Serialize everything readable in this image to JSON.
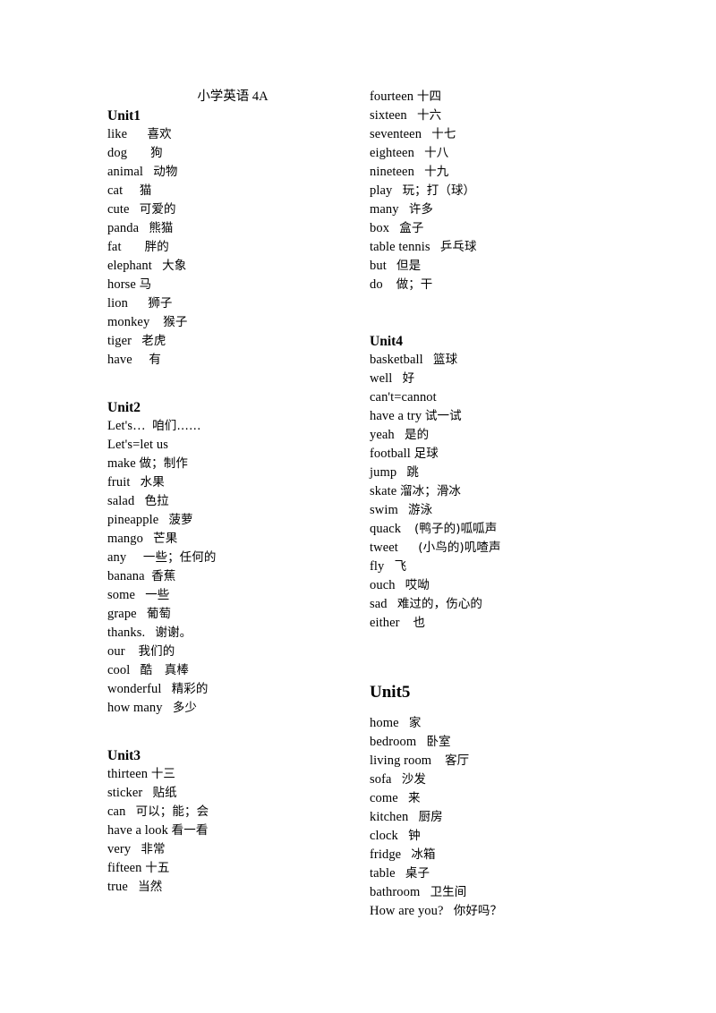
{
  "document": {
    "title": "小学英语 4A"
  },
  "columns": {
    "left": [
      {
        "kind": "heading",
        "label": "Unit1",
        "size": "normal"
      },
      {
        "kind": "entry",
        "term": "like",
        "sep": "      ",
        "gloss": "喜欢"
      },
      {
        "kind": "entry",
        "term": "dog",
        "sep": "       ",
        "gloss": "狗"
      },
      {
        "kind": "entry",
        "term": "animal",
        "sep": "   ",
        "gloss": "动物"
      },
      {
        "kind": "entry",
        "term": "cat",
        "sep": "     ",
        "gloss": "猫"
      },
      {
        "kind": "entry",
        "term": "cute",
        "sep": "   ",
        "gloss": "可爱的"
      },
      {
        "kind": "entry",
        "term": "panda",
        "sep": "   ",
        "gloss": "熊猫"
      },
      {
        "kind": "entry",
        "term": "fat",
        "sep": "       ",
        "gloss": "胖的"
      },
      {
        "kind": "entry",
        "term": "elephant",
        "sep": "   ",
        "gloss": "大象"
      },
      {
        "kind": "entry",
        "term": "horse",
        "sep": " ",
        "gloss": "马"
      },
      {
        "kind": "entry",
        "term": "lion",
        "sep": "      ",
        "gloss": "狮子"
      },
      {
        "kind": "entry",
        "term": "monkey",
        "sep": "    ",
        "gloss": "猴子"
      },
      {
        "kind": "entry",
        "term": "tiger",
        "sep": "   ",
        "gloss": "老虎"
      },
      {
        "kind": "entry",
        "term": "have",
        "sep": "     ",
        "gloss": "有"
      },
      {
        "kind": "spacer",
        "size": "normal"
      },
      {
        "kind": "spacer",
        "size": "half"
      },
      {
        "kind": "heading",
        "label": "Unit2",
        "size": "normal"
      },
      {
        "kind": "entry",
        "term": "Let's…",
        "sep": "  ",
        "gloss": "咱们……"
      },
      {
        "kind": "entry",
        "term": "Let's=let us",
        "sep": "",
        "gloss": ""
      },
      {
        "kind": "entry",
        "term": "make",
        "sep": " ",
        "gloss": "做；制作"
      },
      {
        "kind": "entry",
        "term": "fruit",
        "sep": "   ",
        "gloss": "水果"
      },
      {
        "kind": "entry",
        "term": "salad",
        "sep": "   ",
        "gloss": "色拉"
      },
      {
        "kind": "entry",
        "term": "pineapple",
        "sep": "   ",
        "gloss": "菠萝"
      },
      {
        "kind": "entry",
        "term": "mango",
        "sep": "   ",
        "gloss": "芒果"
      },
      {
        "kind": "entry",
        "term": "any",
        "sep": "     ",
        "gloss": "一些；任何的"
      },
      {
        "kind": "entry",
        "term": "banana",
        "sep": "  ",
        "gloss": "香蕉"
      },
      {
        "kind": "entry",
        "term": "some",
        "sep": "   ",
        "gloss": "一些"
      },
      {
        "kind": "entry",
        "term": "grape",
        "sep": "   ",
        "gloss": "葡萄"
      },
      {
        "kind": "entry",
        "term": "thanks.",
        "sep": "   ",
        "gloss": "谢谢。"
      },
      {
        "kind": "entry",
        "term": "our",
        "sep": "    ",
        "gloss": "我们的"
      },
      {
        "kind": "entry",
        "term": "cool",
        "sep": "   ",
        "gloss": "酷　真棒"
      },
      {
        "kind": "entry",
        "term": "wonderful",
        "sep": "   ",
        "gloss": "精彩的"
      },
      {
        "kind": "entry",
        "term": "how many",
        "sep": "   ",
        "gloss": "多少"
      },
      {
        "kind": "spacer",
        "size": "normal"
      },
      {
        "kind": "spacer",
        "size": "half"
      },
      {
        "kind": "heading",
        "label": "Unit3",
        "size": "normal"
      },
      {
        "kind": "entry",
        "term": "thirteen",
        "sep": " ",
        "gloss": "十三"
      },
      {
        "kind": "entry",
        "term": "sticker",
        "sep": "   ",
        "gloss": "贴纸"
      },
      {
        "kind": "entry",
        "term": "can",
        "sep": "   ",
        "gloss": "可以；能；会"
      },
      {
        "kind": "entry",
        "term": "have a look",
        "sep": " ",
        "gloss": "看一看"
      },
      {
        "kind": "entry",
        "term": "very",
        "sep": "   ",
        "gloss": "非常"
      },
      {
        "kind": "entry",
        "term": "fifteen",
        "sep": " ",
        "gloss": "十五"
      },
      {
        "kind": "entry",
        "term": "true",
        "sep": "   ",
        "gloss": "当然"
      }
    ],
    "right": [
      {
        "kind": "entry",
        "term": "fourteen",
        "sep": " ",
        "gloss": "十四"
      },
      {
        "kind": "entry",
        "term": "sixteen",
        "sep": "   ",
        "gloss": "十六"
      },
      {
        "kind": "entry",
        "term": "seventeen",
        "sep": "   ",
        "gloss": "十七"
      },
      {
        "kind": "entry",
        "term": "eighteen",
        "sep": "   ",
        "gloss": "十八"
      },
      {
        "kind": "entry",
        "term": "nineteen",
        "sep": "   ",
        "gloss": "十九"
      },
      {
        "kind": "entry",
        "term": "play",
        "sep": "   ",
        "gloss": "玩；打（球）"
      },
      {
        "kind": "entry",
        "term": "many",
        "sep": "   ",
        "gloss": "许多"
      },
      {
        "kind": "entry",
        "term": "box",
        "sep": "   ",
        "gloss": "盒子"
      },
      {
        "kind": "entry",
        "term": "table tennis",
        "sep": "   ",
        "gloss": "乒乓球"
      },
      {
        "kind": "entry",
        "term": "but",
        "sep": "   ",
        "gloss": "但是"
      },
      {
        "kind": "entry",
        "term": "do",
        "sep": "    ",
        "gloss": "做；干"
      },
      {
        "kind": "spacer",
        "size": "normal"
      },
      {
        "kind": "spacer",
        "size": "normal"
      },
      {
        "kind": "heading",
        "label": "Unit4",
        "size": "normal"
      },
      {
        "kind": "entry",
        "term": "basketball",
        "sep": "   ",
        "gloss": "篮球"
      },
      {
        "kind": "entry",
        "term": "well",
        "sep": "   ",
        "gloss": "好"
      },
      {
        "kind": "entry",
        "term": "can't=cannot",
        "sep": "",
        "gloss": ""
      },
      {
        "kind": "entry",
        "term": "have a try",
        "sep": " ",
        "gloss": "试一试"
      },
      {
        "kind": "entry",
        "term": "yeah",
        "sep": "   ",
        "gloss": "是的"
      },
      {
        "kind": "entry",
        "term": "football",
        "sep": " ",
        "gloss": "足球"
      },
      {
        "kind": "entry",
        "term": "jump",
        "sep": "   ",
        "gloss": "跳"
      },
      {
        "kind": "entry",
        "term": "skate",
        "sep": " ",
        "gloss": "溜冰；滑冰"
      },
      {
        "kind": "entry",
        "term": "swim",
        "sep": "   ",
        "gloss": "游泳"
      },
      {
        "kind": "entry",
        "term": "quack",
        "sep": "    ",
        "gloss": "(鸭子的)呱呱声"
      },
      {
        "kind": "entry",
        "term": "tweet",
        "sep": "      ",
        "gloss": "(小鸟的)叽喳声"
      },
      {
        "kind": "entry",
        "term": "fly",
        "sep": "   ",
        "gloss": "飞"
      },
      {
        "kind": "entry",
        "term": "ouch",
        "sep": "   ",
        "gloss": "哎呦"
      },
      {
        "kind": "entry",
        "term": "sad",
        "sep": "   ",
        "gloss": "难过的，伤心的"
      },
      {
        "kind": "entry",
        "term": "either",
        "sep": "    ",
        "gloss": "也"
      },
      {
        "kind": "spacer",
        "size": "normal"
      },
      {
        "kind": "spacer",
        "size": "normal"
      },
      {
        "kind": "spacer",
        "size": "half"
      },
      {
        "kind": "heading",
        "label": "Unit5",
        "size": "large"
      },
      {
        "kind": "spacer",
        "size": "half"
      },
      {
        "kind": "entry",
        "term": "home",
        "sep": "   ",
        "gloss": "家"
      },
      {
        "kind": "entry",
        "term": "bedroom",
        "sep": "   ",
        "gloss": "卧室"
      },
      {
        "kind": "entry",
        "term": "living room",
        "sep": "    ",
        "gloss": "客厅"
      },
      {
        "kind": "entry",
        "term": "sofa",
        "sep": "   ",
        "gloss": "沙发"
      },
      {
        "kind": "entry",
        "term": "come",
        "sep": "   ",
        "gloss": "来"
      },
      {
        "kind": "entry",
        "term": "kitchen",
        "sep": "   ",
        "gloss": "厨房"
      },
      {
        "kind": "entry",
        "term": "clock",
        "sep": "   ",
        "gloss": "钟"
      },
      {
        "kind": "entry",
        "term": "fridge",
        "sep": "   ",
        "gloss": "冰箱"
      },
      {
        "kind": "entry",
        "term": "table",
        "sep": "   ",
        "gloss": "桌子"
      },
      {
        "kind": "entry",
        "term": "bathroom",
        "sep": "   ",
        "gloss": "卫生间"
      },
      {
        "kind": "entry",
        "term": "How are you?",
        "sep": "   ",
        "gloss": "你好吗？"
      }
    ]
  }
}
